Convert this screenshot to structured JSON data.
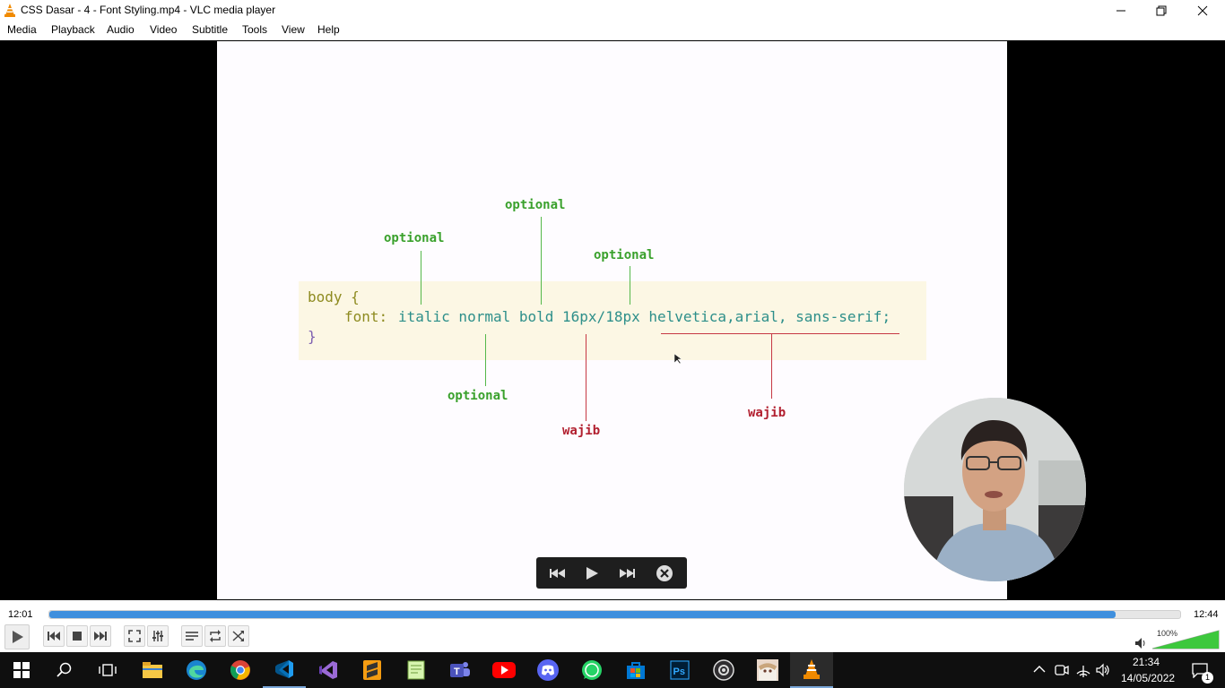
{
  "window": {
    "title": "CSS Dasar - 4 - Font Styling.mp4 - VLC media player"
  },
  "menu": {
    "items": [
      "Media",
      "Playback",
      "Audio",
      "Video",
      "Subtitle",
      "Tools",
      "View",
      "Help"
    ]
  },
  "slide": {
    "code_line1": "body {",
    "code_line2_prop": "font:",
    "code_line2_values": "italic normal bold 16px/18px helvetica,arial, sans-serif;",
    "code_line3": "}",
    "labels_green": [
      "optional",
      "optional",
      "optional",
      "optional"
    ],
    "labels_red": [
      "wajib",
      "wajib"
    ]
  },
  "player": {
    "time_elapsed": "12:01",
    "time_total": "12:44",
    "progress_fraction": 0.943,
    "volume_label": "100%",
    "volume_fraction": 1.0
  },
  "taskbar": {
    "apps": [
      "start-icon",
      "search-icon",
      "task-view-icon",
      "file-explorer-icon",
      "edge-icon",
      "chrome-icon",
      "vscode-icon",
      "visual-studio-icon",
      "sublime-text-icon",
      "notepad-plus-icon",
      "teams-icon",
      "youtube-icon",
      "discord-icon",
      "whatsapp-icon",
      "store-icon",
      "photoshop-icon",
      "obs-icon",
      "anime-app-icon",
      "vlc-icon"
    ],
    "clock_time": "21:34",
    "clock_date": "14/05/2022",
    "notification_count": "1"
  },
  "colors": {
    "accent": "#3f8fdd",
    "label_green": "#3aa12c",
    "label_red": "#b22030",
    "vlc_orange": "#f08a00"
  }
}
